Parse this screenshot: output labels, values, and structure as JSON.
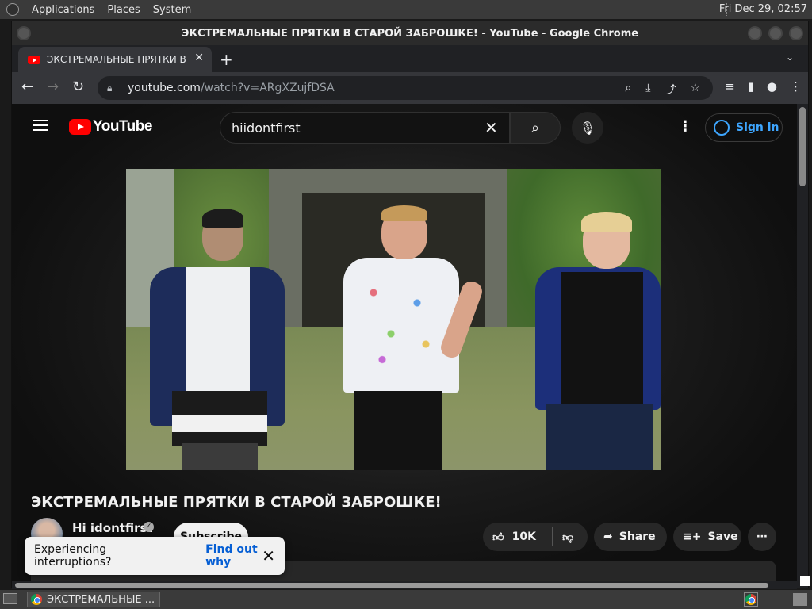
{
  "top_panel": {
    "menus": [
      "Applications",
      "Places",
      "System"
    ],
    "clock": "Fri Dec 29, 02:57"
  },
  "window": {
    "title": "ЭКСТРЕМАЛЬНЫЕ ПРЯТКИ В СТАРОЙ ЗАБРОШКЕ! - YouTube - Google Chrome"
  },
  "tabs": [
    {
      "label": "ЭКСТРЕМАЛЬНЫЕ ПРЯТКИ В СТАРОЙ ЗАБРОШКЕ! - YouTube"
    }
  ],
  "omnibox": {
    "url_host": "youtube.com",
    "url_path": "/watch?v=ARgXZujfDSA"
  },
  "youtube": {
    "logo_text": "YouTube",
    "search_value": "hiidontfirst",
    "sign_in_label": "Sign in",
    "video_title": "ЭКСТРЕМАЛЬНЫЕ ПРЯТКИ В СТАРОЙ ЗАБРОШКЕ!",
    "channel_name": "Hi idontfirst",
    "subscribe_label": "Subscribe",
    "like_count": "10K",
    "share_label": "Share",
    "save_label": "Save"
  },
  "toast": {
    "message": "Experiencing interruptions?",
    "link": "Find out why"
  },
  "taskbar": {
    "task_label": "ЭКСТРЕМАЛЬНЫЕ ..."
  }
}
